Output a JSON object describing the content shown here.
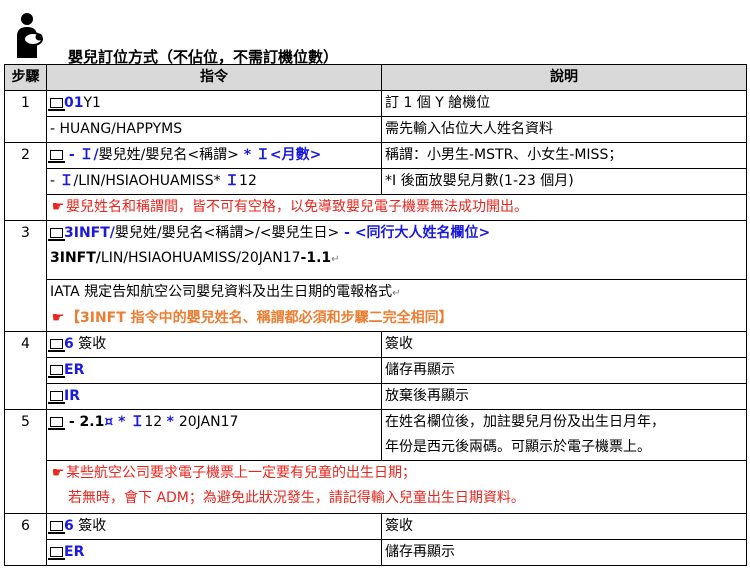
{
  "header": {
    "title": "嬰兒訂位方式（不佔位，不需訂機位數）",
    "icon": "mother-with-baby-icon"
  },
  "columns": {
    "step": "步驟",
    "command": "指令",
    "explanation": "說明"
  },
  "colors": {
    "blue": "#1a1adc",
    "red": "#e8261e",
    "orange": "#ed7d31",
    "header_bg": "#d9d9d9"
  },
  "rows": {
    "r1": {
      "step": "1",
      "cmd1": {
        "a": "01",
        "b": "Y1"
      },
      "cmd2": "- HUANG/HAPPYMS",
      "exp1": "訂 1 個 Y 艙機位",
      "exp2": "需先輸入佔位大人姓名資料"
    },
    "r2": {
      "step": "2",
      "cmd1": {
        "a": " - Ｉ/",
        "b": "嬰兒姓/嬰兒名<稱謂>",
        "c": " * Ｉ<月數>"
      },
      "cmd2": {
        "a": "- ",
        "b": "Ｉ",
        "c": "/LIN/HSIAOHUAMISS* ",
        "d": "Ｉ",
        "e": "12"
      },
      "exp1": "稱謂：小男生-MSTR、小女生-MISS；",
      "exp2": "*I 後面放嬰兒月數(1-23 個月)",
      "note": "嬰兒姓名和稱謂間，皆不可有空格，以免導致嬰兒電子機票無法成功開出。"
    },
    "r3": {
      "step": "3",
      "cmd1": {
        "a": "3INFT/",
        "b": "嬰兒姓/嬰兒名<稱謂>/<嬰兒生日>",
        "c": " - <同行大人姓名欄位>"
      },
      "cmd2": {
        "a": "3INFT/",
        "b": "LIN/HSIAOHUAMISS/20JAN17",
        "c": "-1.1",
        "d": "↵"
      },
      "desc": "IATA 規定告知航空公司嬰兒資料及出生日期的電報格式",
      "desc_mark": "↵",
      "note": "【3INFT 指令中的嬰兒姓名、稱謂都必須和步驟二完全相同】"
    },
    "r4": {
      "step": "4",
      "cmd1": {
        "a": "6",
        "b": " 簽收"
      },
      "cmd2": "ER",
      "cmd3": "IR",
      "exp1": "簽收",
      "exp2": "儲存再顯示",
      "exp3": "放棄後再顯示"
    },
    "r5": {
      "step": "5",
      "cmd1": {
        "a": " - 2.1",
        "b": "¤",
        "c": " * ",
        "d": "Ｉ",
        "e": "12 ",
        "f": "* ",
        "g": "20JAN17"
      },
      "exp1": "在姓名欄位後，加註嬰兒月份及出生日月年，",
      "exp2": "年份是西元後兩碼。可顯示於電子機票上。",
      "note1": "某些航空公司要求電子機票上一定要有兒童的出生日期；",
      "note2": "若無時，會下 ADM；為避免此狀況發生，請記得輸入兒童出生日期資料。"
    },
    "r6": {
      "step": "6",
      "cmd1": {
        "a": "6",
        "b": " 簽收"
      },
      "cmd2": "ER",
      "exp1": "簽收",
      "exp2": "儲存再顯示"
    }
  }
}
